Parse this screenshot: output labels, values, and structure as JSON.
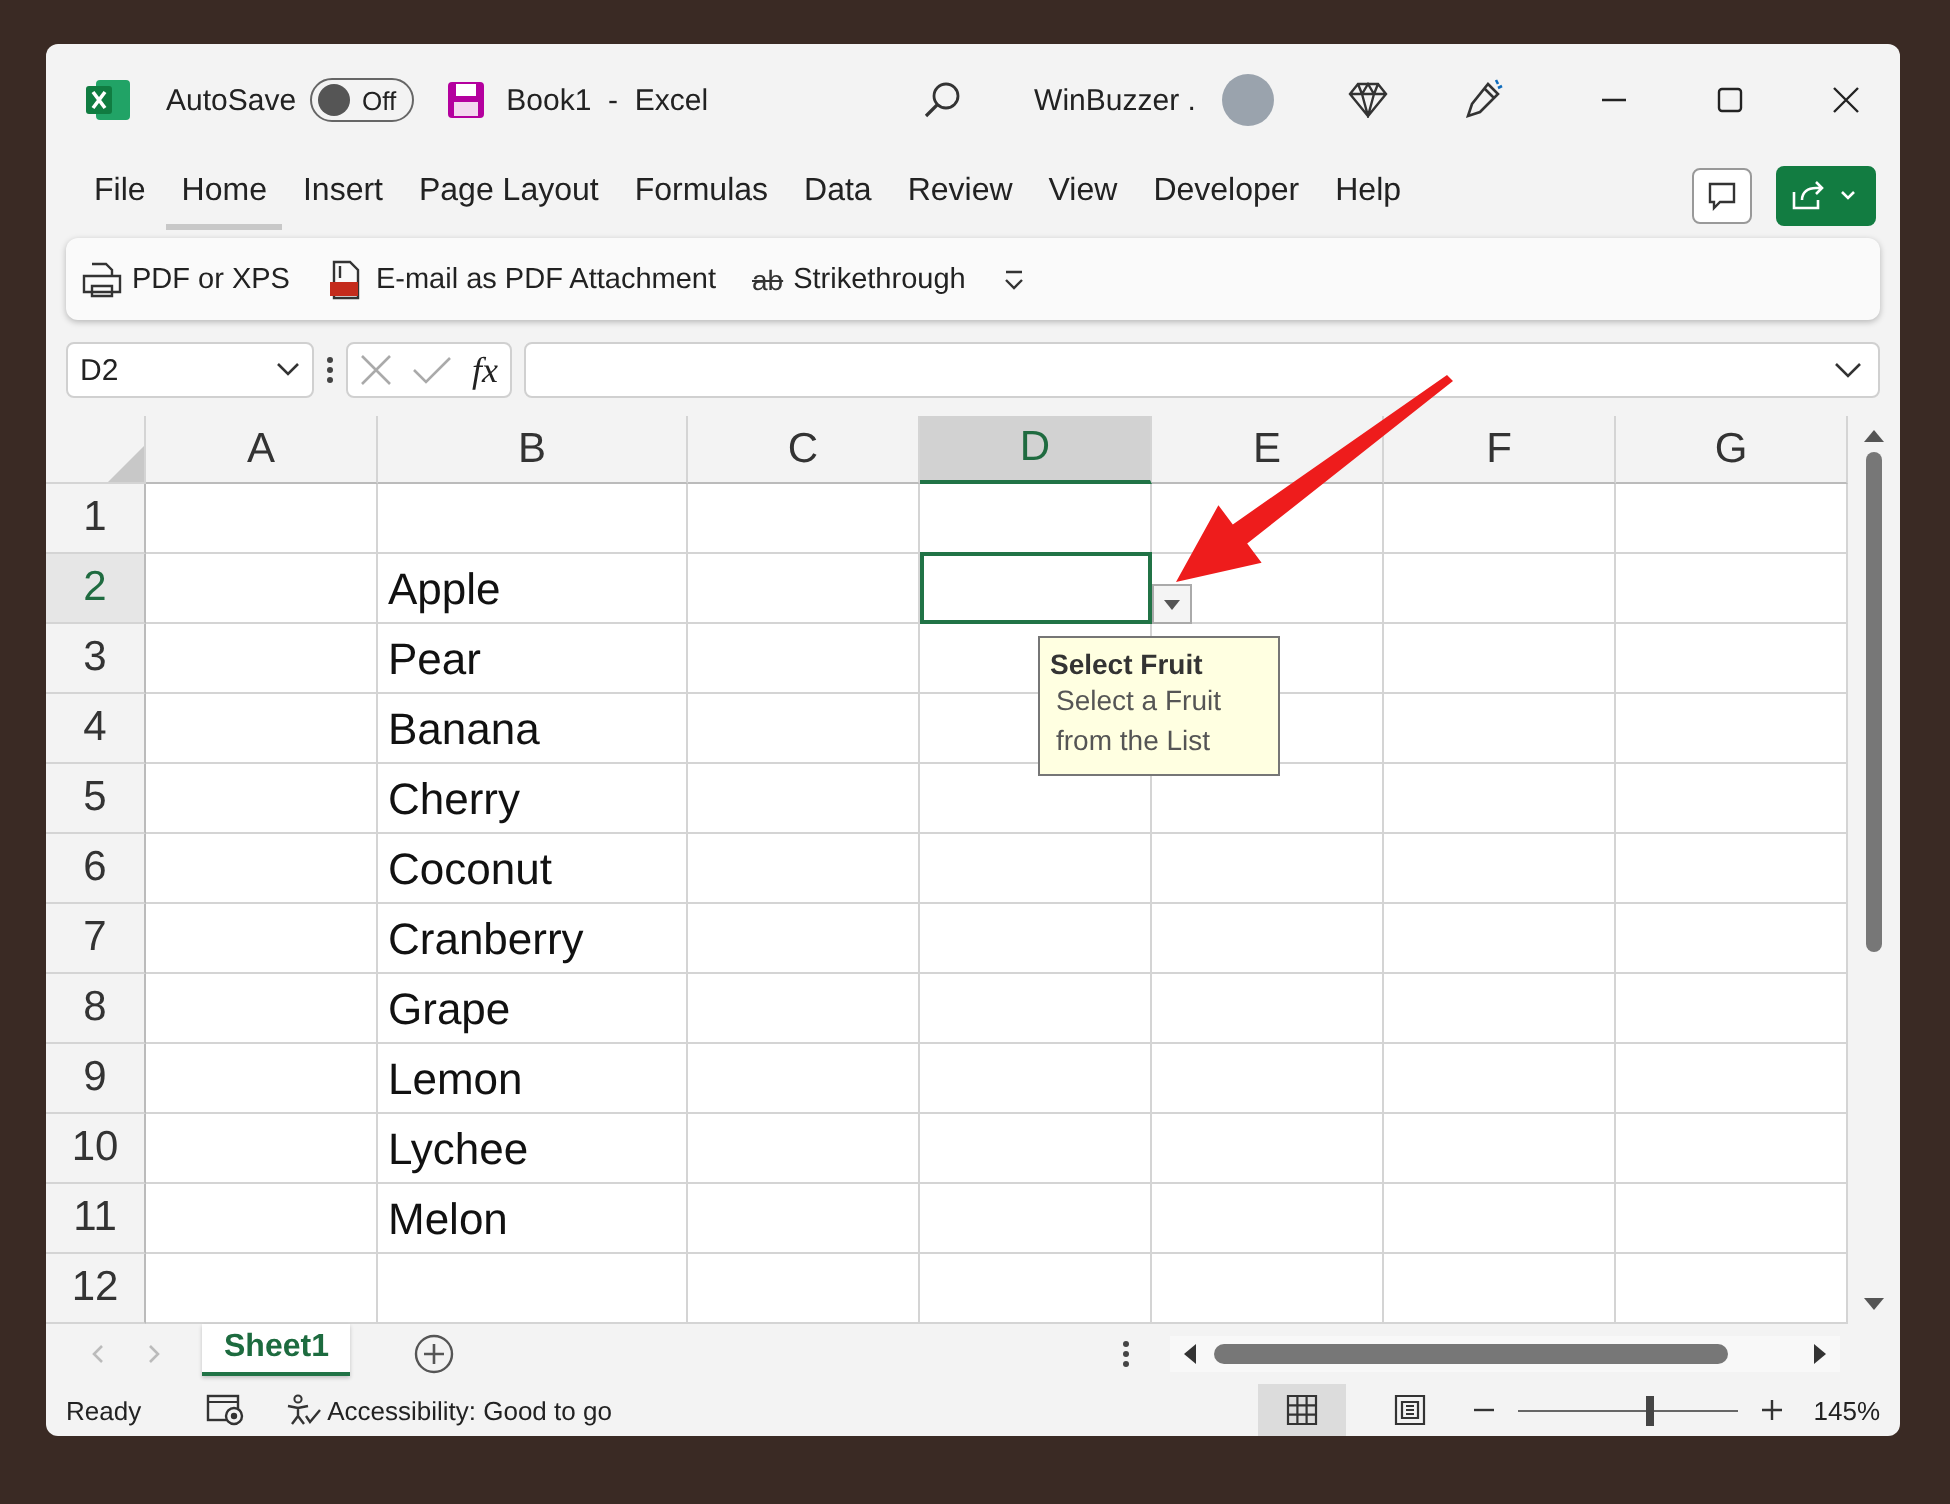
{
  "title_bar": {
    "autosave_label": "AutoSave",
    "autosave_toggle": {
      "label": "Off",
      "on": false
    },
    "document_title": "Book1  -  Excel",
    "account_name": "WinBuzzer ."
  },
  "ribbon_tabs": [
    {
      "label": "File",
      "selected": false
    },
    {
      "label": "Home",
      "selected": true
    },
    {
      "label": "Insert",
      "selected": false
    },
    {
      "label": "Page Layout",
      "selected": false
    },
    {
      "label": "Formulas",
      "selected": false
    },
    {
      "label": "Data",
      "selected": false
    },
    {
      "label": "Review",
      "selected": false
    },
    {
      "label": "View",
      "selected": false
    },
    {
      "label": "Developer",
      "selected": false
    },
    {
      "label": "Help",
      "selected": false
    }
  ],
  "quick_toolbar": [
    {
      "kind": "pdf",
      "label": "PDF or XPS"
    },
    {
      "kind": "email_pdf",
      "label": "E-mail as PDF Attachment"
    },
    {
      "kind": "strikethrough",
      "label": "Strikethrough",
      "glyph": "ab"
    }
  ],
  "formula_bar": {
    "name_box": "D2",
    "function_label": "fx"
  },
  "columns": [
    {
      "label": "A",
      "selected": false
    },
    {
      "label": "B",
      "selected": false
    },
    {
      "label": "C",
      "selected": false
    },
    {
      "label": "D",
      "selected": true
    },
    {
      "label": "E",
      "selected": false
    },
    {
      "label": "F",
      "selected": false
    },
    {
      "label": "G",
      "selected": false
    }
  ],
  "rows": [
    {
      "number": "1",
      "selected": false
    },
    {
      "number": "2",
      "selected": true,
      "B": "Apple"
    },
    {
      "number": "3",
      "selected": false,
      "B": "Pear"
    },
    {
      "number": "4",
      "selected": false,
      "B": "Banana"
    },
    {
      "number": "5",
      "selected": false,
      "B": "Cherry"
    },
    {
      "number": "6",
      "selected": false,
      "B": "Coconut"
    },
    {
      "number": "7",
      "selected": false,
      "B": "Cranberry"
    },
    {
      "number": "8",
      "selected": false,
      "B": "Grape"
    },
    {
      "number": "9",
      "selected": false,
      "B": "Lemon"
    },
    {
      "number": "10",
      "selected": false,
      "B": "Lychee"
    },
    {
      "number": "11",
      "selected": false,
      "B": "Melon"
    },
    {
      "number": "12",
      "selected": false
    }
  ],
  "validation_tooltip": {
    "title": "Select Fruit",
    "message": "Select a Fruit from the List"
  },
  "sheet_tabs": [
    {
      "label": "Sheet1",
      "selected": true
    }
  ],
  "status_bar": {
    "status": "Ready",
    "accessibility": "Accessibility: Good to go",
    "views": [
      {
        "kind": "normal",
        "selected": true
      },
      {
        "kind": "page_layout",
        "selected": false
      }
    ],
    "zoom_slider": {
      "level": 0.6
    },
    "zoom": "145%"
  }
}
